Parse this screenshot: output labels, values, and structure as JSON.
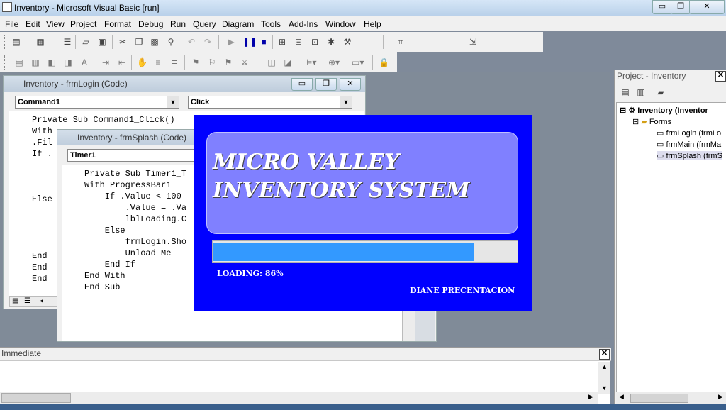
{
  "app": {
    "title": "Inventory - Microsoft Visual Basic [run]",
    "window_buttons": [
      "▭",
      "❐",
      "✕"
    ]
  },
  "menu": [
    "File",
    "Edit",
    "View",
    "Project",
    "Format",
    "Debug",
    "Run",
    "Query",
    "Diagram",
    "Tools",
    "Add-Ins",
    "Window",
    "Help"
  ],
  "code_login": {
    "title": "Inventory - frmLogin (Code)",
    "object": "Command1",
    "procedure": "Click",
    "lines": [
      "Private Sub Command1_Click()",
      "With",
      ".Fil",
      "If .",
      "",
      "",
      "",
      "Else",
      "",
      "",
      "",
      "",
      "End",
      "End",
      "End"
    ]
  },
  "code_splash": {
    "title": "Inventory - frmSplash (Code)",
    "object": "Timer1",
    "lines": [
      "Private Sub Timer1_T",
      "With ProgressBar1",
      "    If .Value < 100",
      "        .Value = .Va",
      "        lblLoading.C",
      "    Else",
      "        frmLogin.Sho",
      "        Unload Me",
      "    End If",
      "End With",
      "End Sub"
    ]
  },
  "splash": {
    "title_line1": "MICRO VALLEY",
    "title_line2": "INVENTORY SYSTEM",
    "progress": 0.86,
    "loading_text": "LOADING: 86%",
    "credit": "DIANE PRECENTACION",
    "background_color": "#0000ff",
    "panel_color": "#8080ff",
    "bar_color": "#3399ff"
  },
  "immediate": {
    "title": "Immediate"
  },
  "project": {
    "title": "Project - Inventory",
    "root": "Inventory (Inventor",
    "folder": "Forms",
    "forms": [
      "frmLogin (frmLo",
      "frmMain (frmMa",
      "frmSplash (frmS"
    ]
  }
}
